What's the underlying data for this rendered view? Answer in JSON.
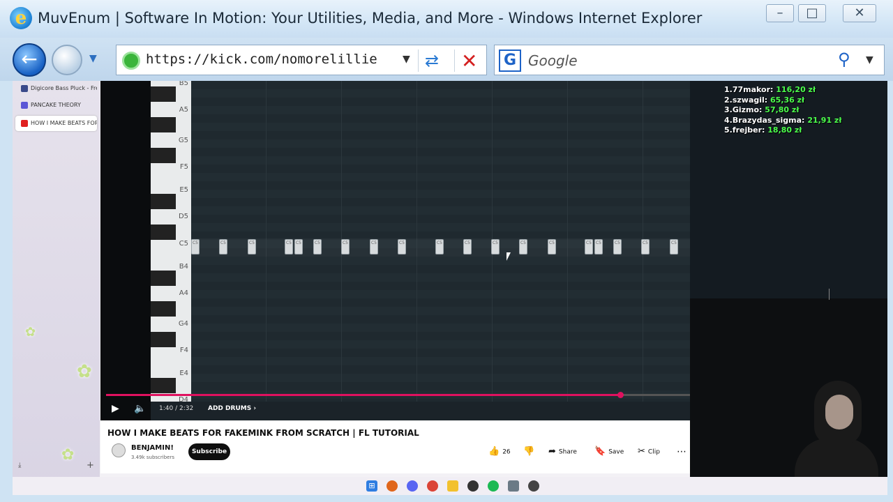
{
  "window": {
    "title": "MuvEnum | Software In Motion: Your Utilities, Media, and More - Windows Internet Explorer",
    "min": "–",
    "max": "□",
    "close": "✕"
  },
  "nav": {
    "back": "←",
    "address": "https://kick.com/nomorelillie",
    "search_placeholder": "Google",
    "search_logo": "G"
  },
  "tabs": [
    {
      "label": "Digicore Bass Pluck - Fre",
      "color": "#3a4a8a"
    },
    {
      "label": "PANCAKE THEORY",
      "color": "#5a56d6"
    },
    {
      "label": "HOW I MAKE BEATS FOR",
      "color": "#e02020"
    }
  ],
  "piano_labels": [
    "B5",
    "A5",
    "G5",
    "F5",
    "E5",
    "D5",
    "C5",
    "B4",
    "A4",
    "G4",
    "F4",
    "E4",
    "D4"
  ],
  "note_label": "C5",
  "player": {
    "time": "1:40 / 2:32",
    "chapter": "ADD DRUMS ›",
    "progress": 0.88
  },
  "video": {
    "title": "HOW I MAKE BEATS FOR FAKEMINK FROM SCRATCH | FL TUTORIAL",
    "channel": "BENJAMIN!",
    "subscribers": "3.49k subscribers",
    "subscribe": "Subscribe",
    "likes": "26",
    "share": "Share",
    "save": "Save",
    "clip": "Clip",
    "more": "⋯"
  },
  "donations": [
    {
      "name": "1.77makor:",
      "amount": "116,20 zł"
    },
    {
      "name": "2.szwagil:",
      "amount": "65,36 zł"
    },
    {
      "name": "3.Gizmo:",
      "amount": "57,80 zł"
    },
    {
      "name": "4.Brazydas_sigma:",
      "amount": "21,91 zł"
    },
    {
      "name": "5.frejber:",
      "amount": "18,80 zł"
    }
  ],
  "taskbar_icons": [
    "windows-icon",
    "firefox-icon",
    "discord-icon",
    "chrome-icon",
    "folder-icon",
    "obs-icon",
    "spotify-icon",
    "calculator-icon",
    "app-icon"
  ]
}
